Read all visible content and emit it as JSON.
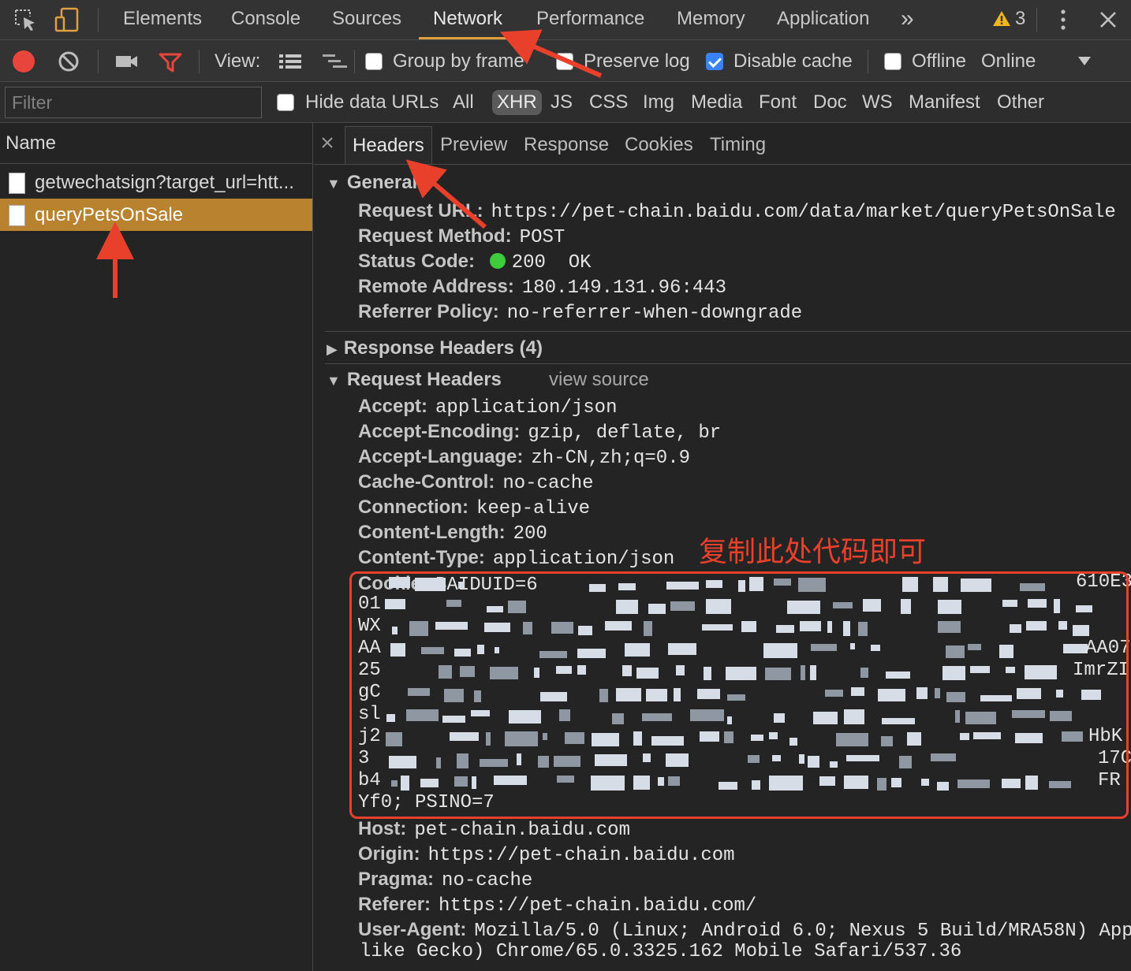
{
  "tabs": {
    "items": [
      "Elements",
      "Console",
      "Sources",
      "Network",
      "Performance",
      "Memory",
      "Application"
    ],
    "active": "Network",
    "more": "»",
    "warning_count": "3"
  },
  "toolbar": {
    "view_label": "View:",
    "group_by_frame": "Group by frame",
    "group_by_frame_checked": false,
    "preserve_log": "Preserve log",
    "preserve_log_checked": false,
    "disable_cache": "Disable cache",
    "disable_cache_checked": true,
    "offline": "Offline",
    "offline_checked": false,
    "throttle_value": "Online"
  },
  "filter": {
    "placeholder": "Filter",
    "hide_data_urls": "Hide data URLs",
    "types": [
      "All",
      "XHR",
      "JS",
      "CSS",
      "Img",
      "Media",
      "Font",
      "Doc",
      "WS",
      "Manifest",
      "Other"
    ],
    "active_type": "XHR"
  },
  "requests": {
    "column_header": "Name",
    "items": [
      {
        "name": "getwechatsign?target_url=htt..."
      },
      {
        "name": "queryPetsOnSale",
        "selected": true
      }
    ]
  },
  "detail": {
    "tabs": [
      "Headers",
      "Preview",
      "Response",
      "Cookies",
      "Timing"
    ],
    "active_tab": "Headers",
    "general": {
      "title": "General",
      "request_url_key": "Request URL:",
      "request_url": "https://pet-chain.baidu.com/data/market/queryPetsOnSale",
      "method_key": "Request Method:",
      "method": "POST",
      "status_key": "Status Code:",
      "status": "200  OK",
      "status_color": "#3ccc3c",
      "remote_key": "Remote Address:",
      "remote": "180.149.131.96:443",
      "referrer_policy_key": "Referrer Policy:",
      "referrer_policy": "no-referrer-when-downgrade"
    },
    "response_headers_title": "Response Headers (4)",
    "request_headers": {
      "title": "Request Headers",
      "view_source": "view source",
      "rows": [
        {
          "key": "Accept:",
          "value": "application/json"
        },
        {
          "key": "Accept-Encoding:",
          "value": "gzip, deflate, br"
        },
        {
          "key": "Accept-Language:",
          "value": "zh-CN,zh;q=0.9"
        },
        {
          "key": "Cache-Control:",
          "value": "no-cache"
        },
        {
          "key": "Connection:",
          "value": "keep-alive"
        },
        {
          "key": "Content-Length:",
          "value": "200"
        },
        {
          "key": "Content-Type:",
          "value": "application/json"
        }
      ],
      "cookie_key": "Cookie:",
      "cookie_visible_fragments": {
        "line1_start": "BAIDUID=6",
        "line1_end": "610E3",
        "line2_start": "01",
        "line3_start": "WX",
        "line4_start": "AA",
        "line4_end": "AA07",
        "line5_start": "25",
        "line5_end": "ImrZI",
        "line6_start": "gC",
        "line7_start": "sl",
        "line8_start": "j2",
        "line8_end": "HbK",
        "line9_start": "3",
        "line9_end": "17C",
        "line10_start": "b4",
        "line10_end": "FR",
        "line11": "Yf0; PSINO=7"
      },
      "rows_after": [
        {
          "key": "Host:",
          "value": "pet-chain.baidu.com"
        },
        {
          "key": "Origin:",
          "value": "https://pet-chain.baidu.com"
        },
        {
          "key": "Pragma:",
          "value": "no-cache"
        },
        {
          "key": "Referer:",
          "value": "https://pet-chain.baidu.com/"
        },
        {
          "key": "User-Agent:",
          "value": "Mozilla/5.0 (Linux; Android 6.0; Nexus 5 Build/MRA58N) App"
        }
      ],
      "user_agent_cont": "like Gecko) Chrome/65.0.3325.162 Mobile Safari/537.36"
    }
  },
  "annotation": {
    "text": "复制此处代码即可",
    "color": "#e8402a"
  }
}
